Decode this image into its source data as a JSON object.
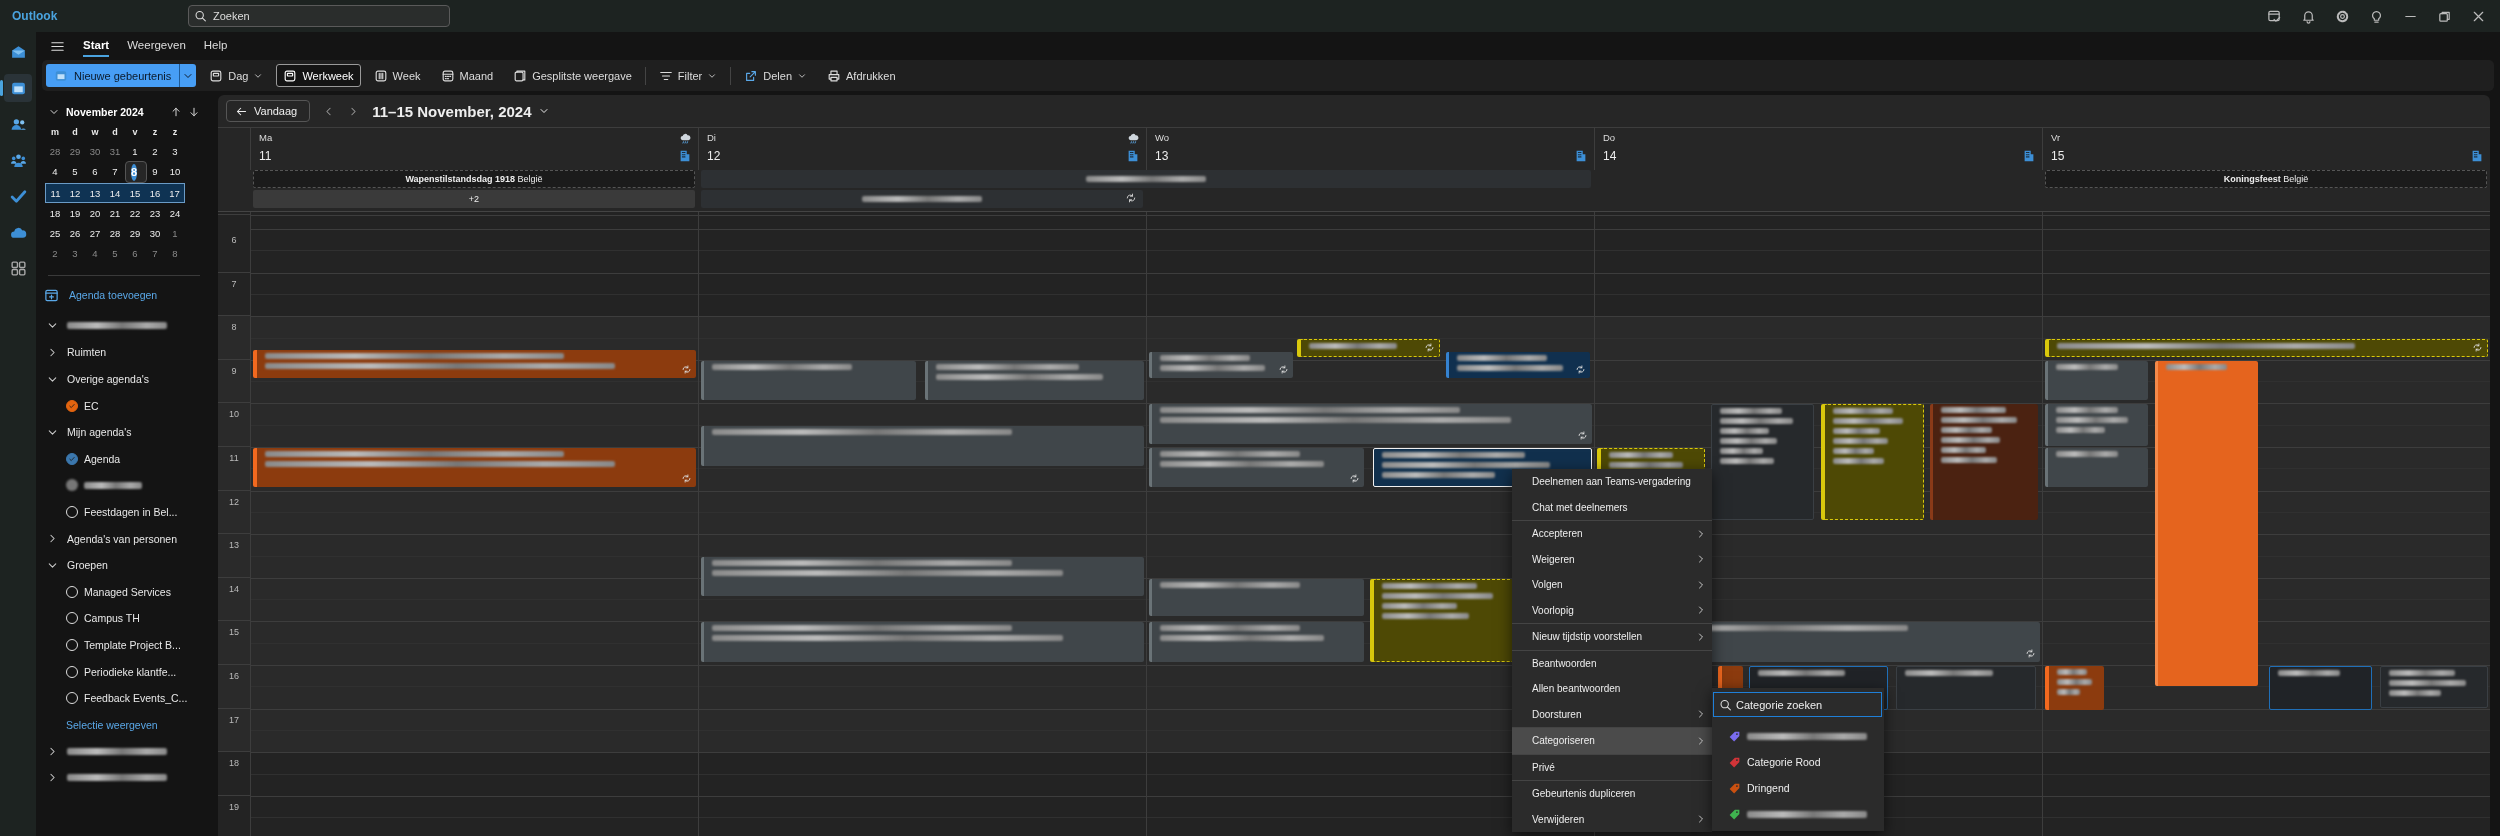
{
  "app": {
    "name": "Outlook"
  },
  "search": {
    "placeholder": "Zoeken"
  },
  "title_actions": [
    {
      "kind": "caltick"
    },
    {
      "kind": "bell"
    },
    {
      "kind": "gear"
    },
    {
      "kind": "bulb"
    },
    {
      "kind": "minimize"
    },
    {
      "kind": "restore"
    },
    {
      "kind": "close"
    }
  ],
  "rail": [
    {
      "kind": "mail",
      "selected": false
    },
    {
      "kind": "calendar",
      "selected": true
    },
    {
      "kind": "people",
      "selected": false
    },
    {
      "kind": "groups",
      "selected": false
    },
    {
      "kind": "todo",
      "selected": false
    },
    {
      "kind": "cloud",
      "selected": false
    },
    {
      "kind": "apps",
      "selected": false
    }
  ],
  "ribbon_tabs": [
    {
      "label": "Start",
      "selected": true
    },
    {
      "label": "Weergeven",
      "selected": false
    },
    {
      "label": "Help",
      "selected": false
    }
  ],
  "ribbon": {
    "new_event": "Nieuwe gebeurtenis",
    "views": [
      {
        "label": "Dag",
        "dropdown": true,
        "selected": false
      },
      {
        "label": "Werkweek",
        "dropdown": false,
        "selected": true
      },
      {
        "label": "Week",
        "dropdown": false,
        "selected": false
      },
      {
        "label": "Maand",
        "dropdown": false,
        "selected": false
      },
      {
        "label": "Gesplitste weergave",
        "dropdown": false,
        "selected": false
      }
    ],
    "filter": "Filter",
    "share": "Delen",
    "print": "Afdrukken"
  },
  "mini_calendar": {
    "title": "November 2024",
    "weekdays": [
      "m",
      "d",
      "w",
      "d",
      "v",
      "z",
      "z"
    ],
    "weeks": [
      {
        "selected": false,
        "days": [
          {
            "label": "28",
            "dim": true,
            "today": false
          },
          {
            "label": "29",
            "dim": true,
            "today": false
          },
          {
            "label": "30",
            "dim": true,
            "today": false
          },
          {
            "label": "31",
            "dim": true,
            "today": false
          },
          {
            "label": "1",
            "dim": false,
            "today": false
          },
          {
            "label": "2",
            "dim": false,
            "today": false
          },
          {
            "label": "3",
            "dim": false,
            "today": false
          }
        ]
      },
      {
        "selected": false,
        "days": [
          {
            "label": "4",
            "dim": false,
            "today": false
          },
          {
            "label": "5",
            "dim": false,
            "today": false
          },
          {
            "label": "6",
            "dim": false,
            "today": false
          },
          {
            "label": "7",
            "dim": false,
            "today": false
          },
          {
            "label": "8",
            "dim": false,
            "today": true
          },
          {
            "label": "9",
            "dim": false,
            "today": false
          },
          {
            "label": "10",
            "dim": false,
            "today": false
          }
        ]
      },
      {
        "selected": true,
        "days": [
          {
            "label": "11",
            "dim": false,
            "today": false
          },
          {
            "label": "12",
            "dim": false,
            "today": false
          },
          {
            "label": "13",
            "dim": false,
            "today": false
          },
          {
            "label": "14",
            "dim": false,
            "today": false
          },
          {
            "label": "15",
            "dim": false,
            "today": false
          },
          {
            "label": "16",
            "dim": false,
            "today": false
          },
          {
            "label": "17",
            "dim": false,
            "today": false
          }
        ]
      },
      {
        "selected": false,
        "days": [
          {
            "label": "18",
            "dim": false,
            "today": false
          },
          {
            "label": "19",
            "dim": false,
            "today": false
          },
          {
            "label": "20",
            "dim": false,
            "today": false
          },
          {
            "label": "21",
            "dim": false,
            "today": false
          },
          {
            "label": "22",
            "dim": false,
            "today": false
          },
          {
            "label": "23",
            "dim": false,
            "today": false
          },
          {
            "label": "24",
            "dim": false,
            "today": false
          }
        ]
      },
      {
        "selected": false,
        "days": [
          {
            "label": "25",
            "dim": false,
            "today": false
          },
          {
            "label": "26",
            "dim": false,
            "today": false
          },
          {
            "label": "27",
            "dim": false,
            "today": false
          },
          {
            "label": "28",
            "dim": false,
            "today": false
          },
          {
            "label": "29",
            "dim": false,
            "today": false
          },
          {
            "label": "30",
            "dim": false,
            "today": false
          },
          {
            "label": "1",
            "dim": true,
            "today": false
          }
        ]
      },
      {
        "selected": false,
        "days": [
          {
            "label": "2",
            "dim": true,
            "today": false
          },
          {
            "label": "3",
            "dim": true,
            "today": false
          },
          {
            "label": "4",
            "dim": true,
            "today": false
          },
          {
            "label": "5",
            "dim": true,
            "today": false
          },
          {
            "label": "6",
            "dim": true,
            "today": false
          },
          {
            "label": "7",
            "dim": true,
            "today": false
          },
          {
            "label": "8",
            "dim": true,
            "today": false
          }
        ]
      }
    ]
  },
  "sidebar": {
    "add_calendar": "Agenda toevoegen",
    "tree": [
      {
        "kind": "account",
        "expanded": true,
        "children": [
          {
            "kind": "folder",
            "label": "Ruimten",
            "expanded": false
          },
          {
            "kind": "folder",
            "label": "Overige agenda's",
            "expanded": true,
            "children": [
              {
                "kind": "calendar",
                "label": "EC",
                "checked": true,
                "color": "#e2640f"
              }
            ]
          },
          {
            "kind": "folder",
            "label": "Mijn agenda's",
            "expanded": true,
            "children": [
              {
                "kind": "calendar",
                "label": "Agenda",
                "checked": true,
                "color": "#3b77ad"
              },
              {
                "kind": "person"
              },
              {
                "kind": "calendar",
                "label": "Feestdagen in Bel...",
                "checked": false
              }
            ]
          },
          {
            "kind": "folder",
            "label": "Agenda's van personen",
            "expanded": false
          },
          {
            "kind": "folder",
            "label": "Groepen",
            "expanded": true,
            "children": [
              {
                "kind": "calendar",
                "label": "Managed Services",
                "checked": false
              },
              {
                "kind": "calendar",
                "label": "Campus TH",
                "checked": false
              },
              {
                "kind": "calendar",
                "label": "Template Project B...",
                "checked": false
              },
              {
                "kind": "calendar",
                "label": "Periodieke klantfe...",
                "checked": false
              },
              {
                "kind": "calendar",
                "label": "Feedback Events_C...",
                "checked": false
              },
              {
                "kind": "link",
                "label": "Selectie weergeven"
              }
            ]
          }
        ]
      },
      {
        "kind": "account",
        "expanded": false
      },
      {
        "kind": "account",
        "expanded": false
      }
    ]
  },
  "calendar": {
    "today_button": "Vandaag",
    "range": "11–15 November, 2024",
    "days": [
      {
        "name": "Ma",
        "number": "11",
        "weather": true,
        "holiday": "**Wapenstilstandsdag 1918** België",
        "more": "+2"
      },
      {
        "name": "Di",
        "number": "12",
        "weather": true
      },
      {
        "name": "Wo",
        "number": "13",
        "weather": false
      },
      {
        "name": "Do",
        "number": "14",
        "weather": false
      },
      {
        "name": "Vr",
        "number": "15",
        "weather": false,
        "holiday": "**Koningsfeest** België"
      }
    ],
    "hours": [
      "6",
      "7",
      "8",
      "9",
      "10",
      "11",
      "12",
      "13",
      "14",
      "15",
      "16",
      "17",
      "18",
      "19"
    ]
  },
  "context_menu": {
    "items": [
      {
        "label": "Deelnemen aan Teams-vergadering",
        "submenu": false,
        "selected": false,
        "divider_before": false
      },
      {
        "label": "Chat met deelnemers",
        "submenu": false,
        "selected": false,
        "divider_before": false
      },
      {
        "label": "Accepteren",
        "submenu": true,
        "selected": false,
        "divider_before": true
      },
      {
        "label": "Weigeren",
        "submenu": true,
        "selected": false,
        "divider_before": false
      },
      {
        "label": "Volgen",
        "submenu": true,
        "selected": false,
        "divider_before": false
      },
      {
        "label": "Voorlopig",
        "submenu": true,
        "selected": false,
        "divider_before": false
      },
      {
        "label": "Nieuw tijdstip voorstellen",
        "submenu": true,
        "selected": false,
        "divider_before": true
      },
      {
        "label": "Beantwoorden",
        "submenu": false,
        "selected": false,
        "divider_before": true
      },
      {
        "label": "Allen beantwoorden",
        "submenu": false,
        "selected": false,
        "divider_before": false
      },
      {
        "label": "Doorsturen",
        "submenu": true,
        "selected": false,
        "divider_before": false
      },
      {
        "label": "Categoriseren",
        "submenu": true,
        "selected": true,
        "divider_before": true
      },
      {
        "label": "Privé",
        "submenu": false,
        "selected": false,
        "divider_before": true
      },
      {
        "label": "Gebeurtenis dupliceren",
        "submenu": false,
        "selected": false,
        "divider_before": true
      },
      {
        "label": "Verwijderen",
        "submenu": true,
        "selected": false,
        "divider_before": false
      }
    ]
  },
  "category_menu": {
    "search_placeholder": "Categorie zoeken",
    "items": [
      {
        "color": "#7b6cf0"
      },
      {
        "label": "Categorie Rood",
        "color": "#d13438"
      },
      {
        "label": "Dringend",
        "color": "#ca5010"
      },
      {
        "color": "#3fb34f"
      }
    ]
  }
}
